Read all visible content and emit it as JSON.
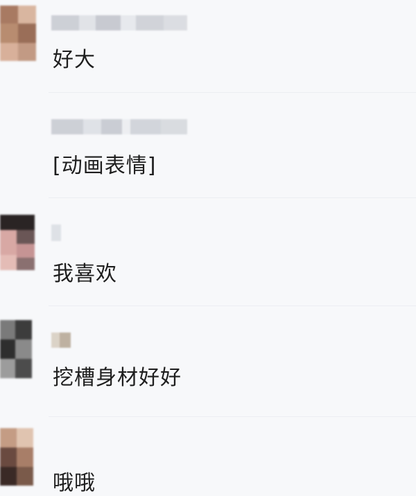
{
  "messages": [
    {
      "text": "好大"
    },
    {
      "text": "[动画表情]"
    },
    {
      "text": "我喜欢"
    },
    {
      "text": "挖槽身材好好"
    },
    {
      "text": "哦哦"
    }
  ]
}
